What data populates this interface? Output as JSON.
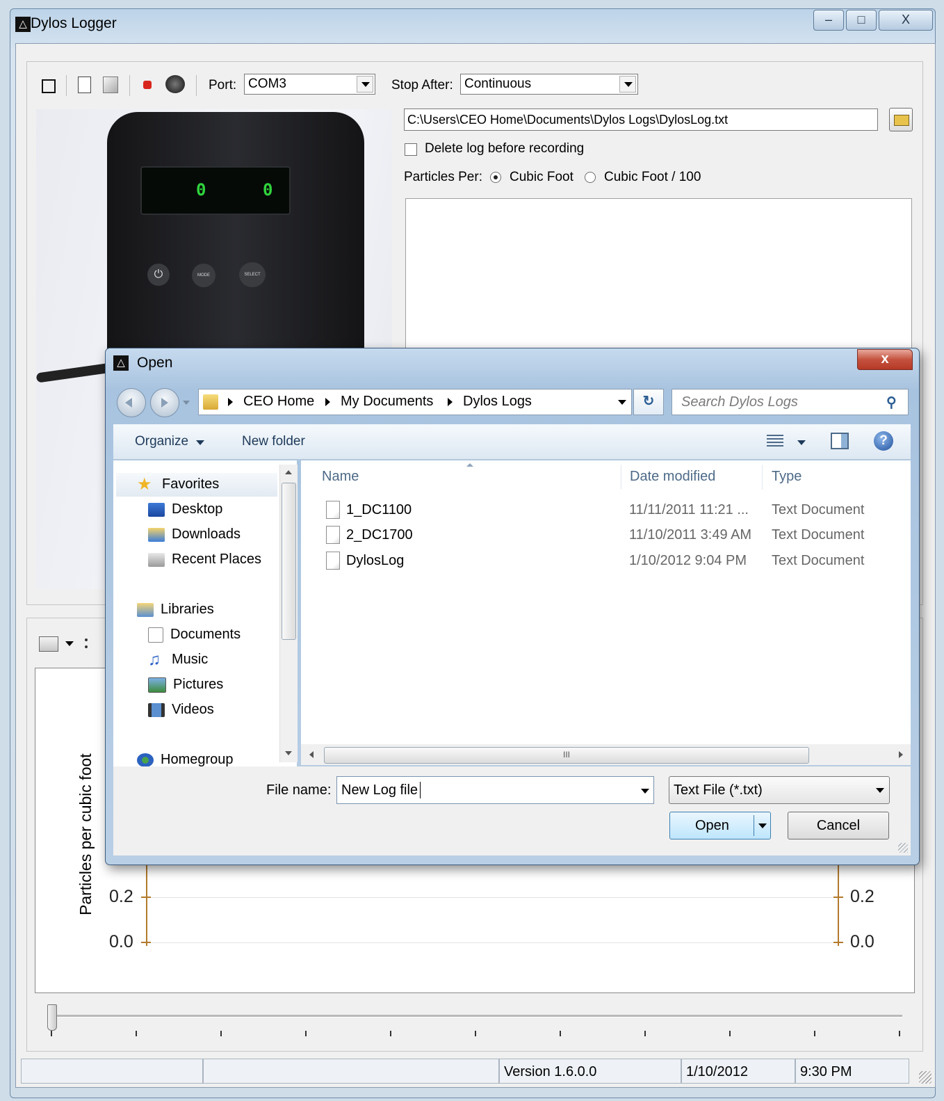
{
  "main_window": {
    "title": "Dylos Logger",
    "caption_min": "–",
    "caption_max": "□",
    "caption_close": "X"
  },
  "toolbar": {
    "port_label": "Port:",
    "port_value": "COM3",
    "stop_after_label": "Stop After:",
    "stop_after_value": "Continuous"
  },
  "log": {
    "path": "C:\\Users\\CEO Home\\Documents\\Dylos Logs\\DylosLog.txt",
    "delete_label": "Delete log before recording",
    "particles_per_label": "Particles Per:",
    "radio_cubic_foot": "Cubic Foot",
    "radio_cubic_foot_100": "Cubic Foot / 100"
  },
  "device_display": {
    "small": "0",
    "large": "0",
    "button_mode": "MODE",
    "button_select": "SELECT"
  },
  "graph": {
    "ylabel": "Particles per cubic foot",
    "ticks_left": [
      "0.2",
      "0.0"
    ],
    "ticks_right": [
      "0.2",
      "0.0"
    ]
  },
  "status_bar": {
    "version": "Version 1.6.0.0",
    "date": "1/10/2012",
    "time": "9:30 PM"
  },
  "dialog": {
    "title": "Open",
    "close": "x",
    "breadcrumb": [
      "CEO Home",
      "My Documents",
      "Dylos Logs"
    ],
    "search_placeholder": "Search Dylos Logs",
    "organize": "Organize",
    "new_folder": "New folder",
    "nav": {
      "favorites": "Favorites",
      "desktop": "Desktop",
      "downloads": "Downloads",
      "recent_places": "Recent Places",
      "libraries": "Libraries",
      "documents": "Documents",
      "music": "Music",
      "pictures": "Pictures",
      "videos": "Videos",
      "homegroup": "Homegroup"
    },
    "columns": {
      "name": "Name",
      "date": "Date modified",
      "type": "Type"
    },
    "files": [
      {
        "name": "1_DC1100",
        "date": "11/11/2011 11:21 ...",
        "type": "Text Document"
      },
      {
        "name": "2_DC1700",
        "date": "11/10/2011 3:49 AM",
        "type": "Text Document"
      },
      {
        "name": "DylosLog",
        "date": "1/10/2012 9:04 PM",
        "type": "Text Document"
      }
    ],
    "scroll_grip": "III",
    "file_name_label": "File name:",
    "file_name_value": "New Log file",
    "file_type": "Text File (*.txt)",
    "open_button": "Open",
    "cancel_button": "Cancel"
  },
  "colors": {
    "accent": "#2b5e94",
    "axis": "#b27a2c",
    "led": "#2fd33c"
  },
  "icons": [
    "app-icon",
    "stop-icon",
    "new-file-icon",
    "delete-file-icon",
    "record-icon",
    "connect-icon",
    "folder-open-icon",
    "chart-icon",
    "legend-icon",
    "star-icon",
    "desktop-icon",
    "downloads-icon",
    "recent-icon",
    "libraries-icon",
    "documents-icon",
    "music-icon",
    "pictures-icon",
    "videos-icon",
    "homegroup-icon",
    "search-icon",
    "refresh-icon",
    "view-icon",
    "preview-pane-icon",
    "help-icon",
    "text-file-icon"
  ]
}
